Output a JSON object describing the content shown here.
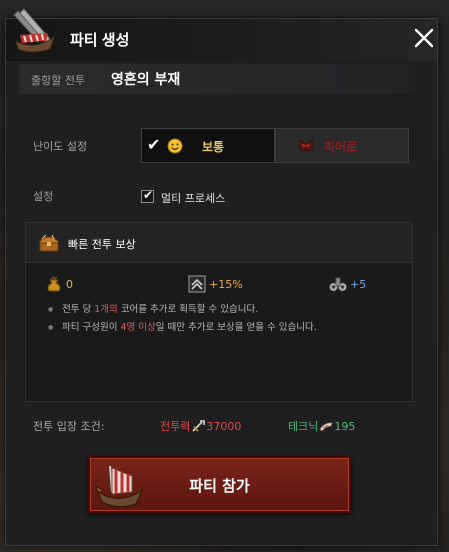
{
  "window": {
    "title": "파티 생성"
  },
  "destination": {
    "label": "출항할 전투",
    "value": "영혼의 부재"
  },
  "difficulty": {
    "label": "난이도 설정",
    "options": [
      {
        "label": "보통",
        "selected": true,
        "icon": "smile-icon"
      },
      {
        "label": "히어로",
        "selected": false,
        "icon": "demon-mask-icon"
      }
    ]
  },
  "settings": {
    "label": "설정",
    "multi_process": {
      "label": "멀티 프로세스",
      "checked": true
    }
  },
  "reward": {
    "title": "빠른 전투 보상",
    "stats": [
      {
        "icon": "gold-pouch-icon",
        "value": "0"
      },
      {
        "icon": "rank-badge-icon",
        "value": "+15%"
      },
      {
        "icon": "binoculars-icon",
        "value": "+5"
      }
    ],
    "notes": [
      {
        "pre": "전투 당 ",
        "hl": "1개의",
        "post": " 코어를 추가로 획득할 수 있습니다."
      },
      {
        "pre": "파티 구성원이 ",
        "hl": "4명 이상",
        "post": "일 때만 추가로 보상을 얻을 수 있습니다."
      }
    ]
  },
  "requirements": {
    "label": "전투 입장 조건:",
    "combat_power": {
      "label": "전투력",
      "value": "37000"
    },
    "technique": {
      "label": "테크닉",
      "value": "195"
    }
  },
  "join_button": {
    "label": "파티 참가"
  },
  "colors": {
    "accent_gold": "#e8c85a",
    "hero_red": "#8a2020",
    "highlight_red": "#e05a5a",
    "stat_gold": "#e8b040",
    "stat_blue": "#6fa8d8",
    "tech_green": "#4fb87a",
    "button_red": "#6a1d13"
  }
}
